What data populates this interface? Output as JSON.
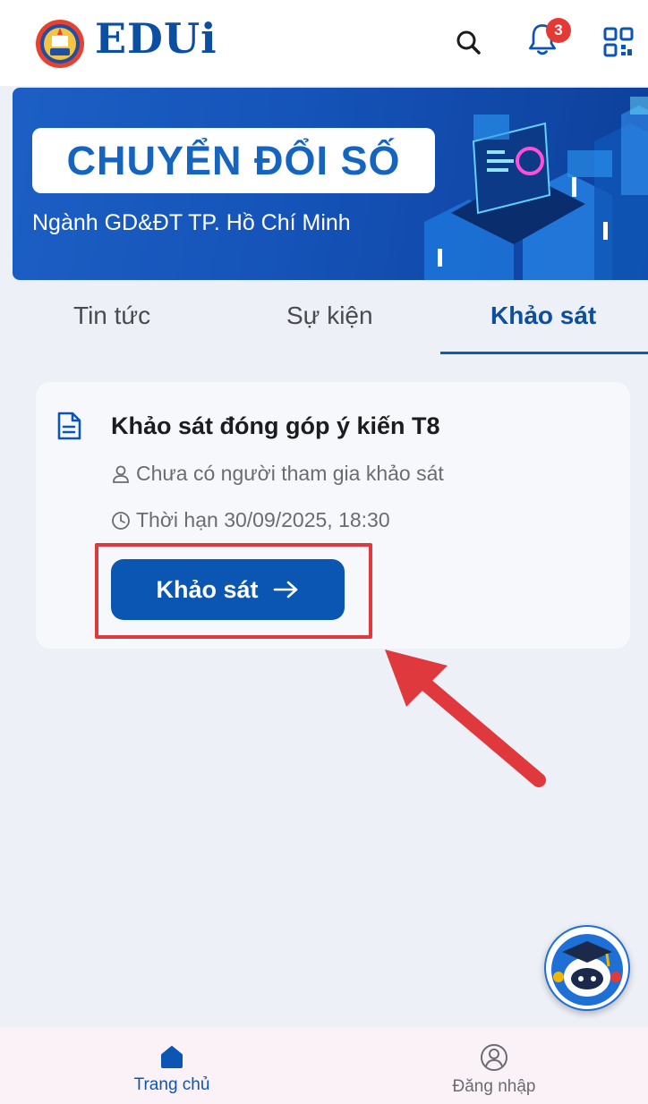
{
  "app": {
    "brand": "EDUi",
    "notification_count": "3"
  },
  "banner": {
    "title": "CHUYỂN ĐỔI SỐ",
    "subtitle": "Ngành GD&ĐT TP. Hồ Chí Minh"
  },
  "tabs": [
    {
      "label": "Tin tức",
      "active": false
    },
    {
      "label": "Sự kiện",
      "active": false
    },
    {
      "label": "Khảo sát",
      "active": true
    }
  ],
  "survey": {
    "title": "Khảo sát đóng góp ý kiến T8",
    "participants": "Chưa có người tham gia khảo sát",
    "deadline": "Thời hạn 30/09/2025, 18:30",
    "button_label": "Khảo sát"
  },
  "bottom_nav": [
    {
      "label": "Trang chủ",
      "icon": "home-icon",
      "active": true
    },
    {
      "label": "Đăng nhập",
      "icon": "user-circle-icon",
      "active": false
    }
  ],
  "colors": {
    "primary": "#0b56b3",
    "brand": "#0b4ea2",
    "badge": "#e53935",
    "highlight": "#e0393d",
    "background": "#eef0f7"
  }
}
